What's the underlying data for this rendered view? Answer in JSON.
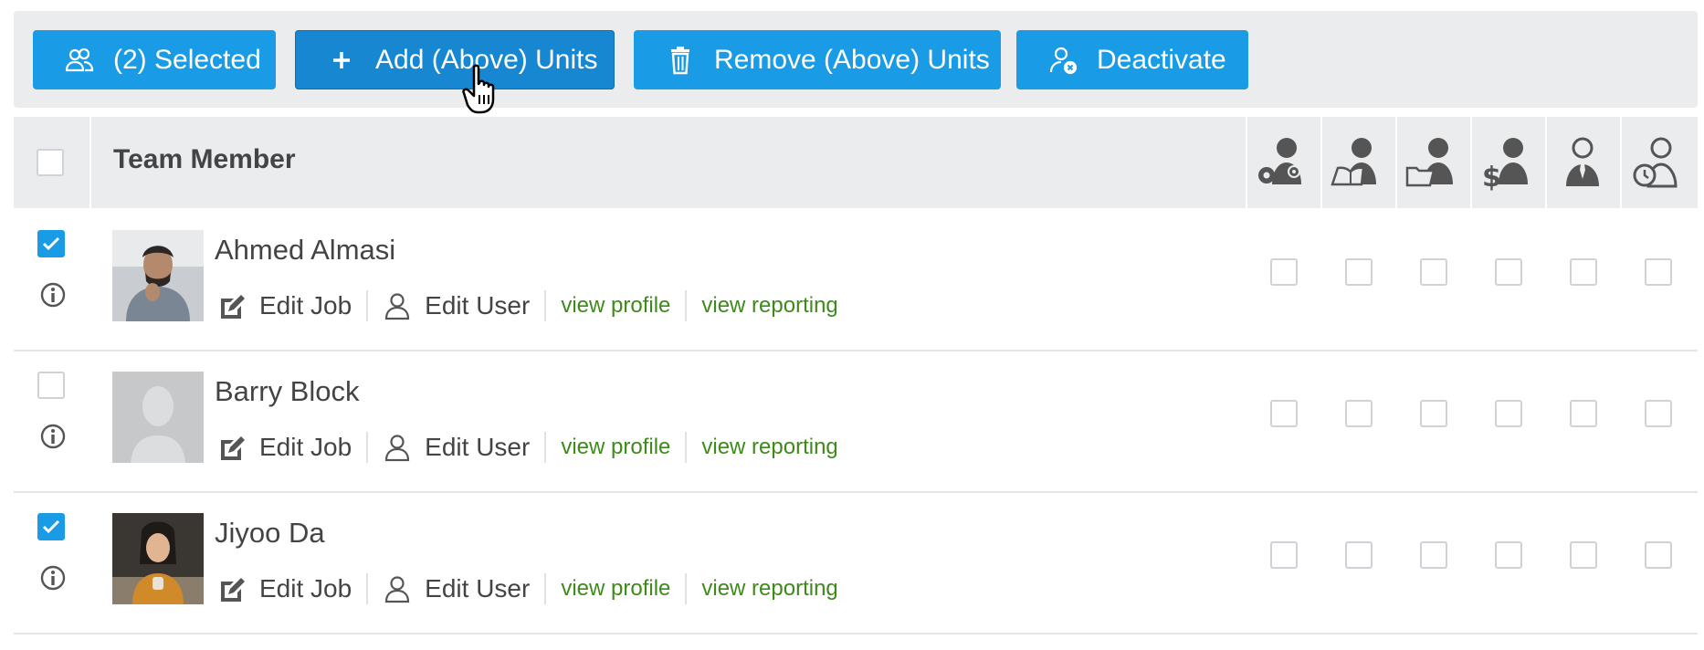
{
  "toolbar": {
    "selected_label": "(2) Selected",
    "add_label": "Add (Above) Units",
    "remove_label": "Remove (Above) Units",
    "deactivate_label": "Deactivate",
    "accent_color": "#1a9be6"
  },
  "table": {
    "header_title": "Team Member",
    "header_checkbox_checked": false,
    "role_columns": [
      {
        "icon": "settings-person-icon"
      },
      {
        "icon": "reading-person-icon"
      },
      {
        "icon": "folder-person-icon"
      },
      {
        "icon": "finance-person-icon"
      },
      {
        "icon": "manager-person-icon"
      },
      {
        "icon": "timer-person-icon"
      }
    ]
  },
  "rows": [
    {
      "name": "Ahmed Almasi",
      "checked": true,
      "avatar": "photo-man",
      "edit_job": "Edit Job",
      "edit_user": "Edit User",
      "view_profile": "view profile",
      "view_reporting": "view reporting"
    },
    {
      "name": "Barry Block",
      "checked": false,
      "avatar": "placeholder-silhouette",
      "edit_job": "Edit Job",
      "edit_user": "Edit User",
      "view_profile": "view profile",
      "view_reporting": "view reporting"
    },
    {
      "name": "Jiyoo Da",
      "checked": true,
      "avatar": "photo-woman",
      "edit_job": "Edit Job",
      "edit_user": "Edit User",
      "view_profile": "view profile",
      "view_reporting": "view reporting"
    }
  ]
}
